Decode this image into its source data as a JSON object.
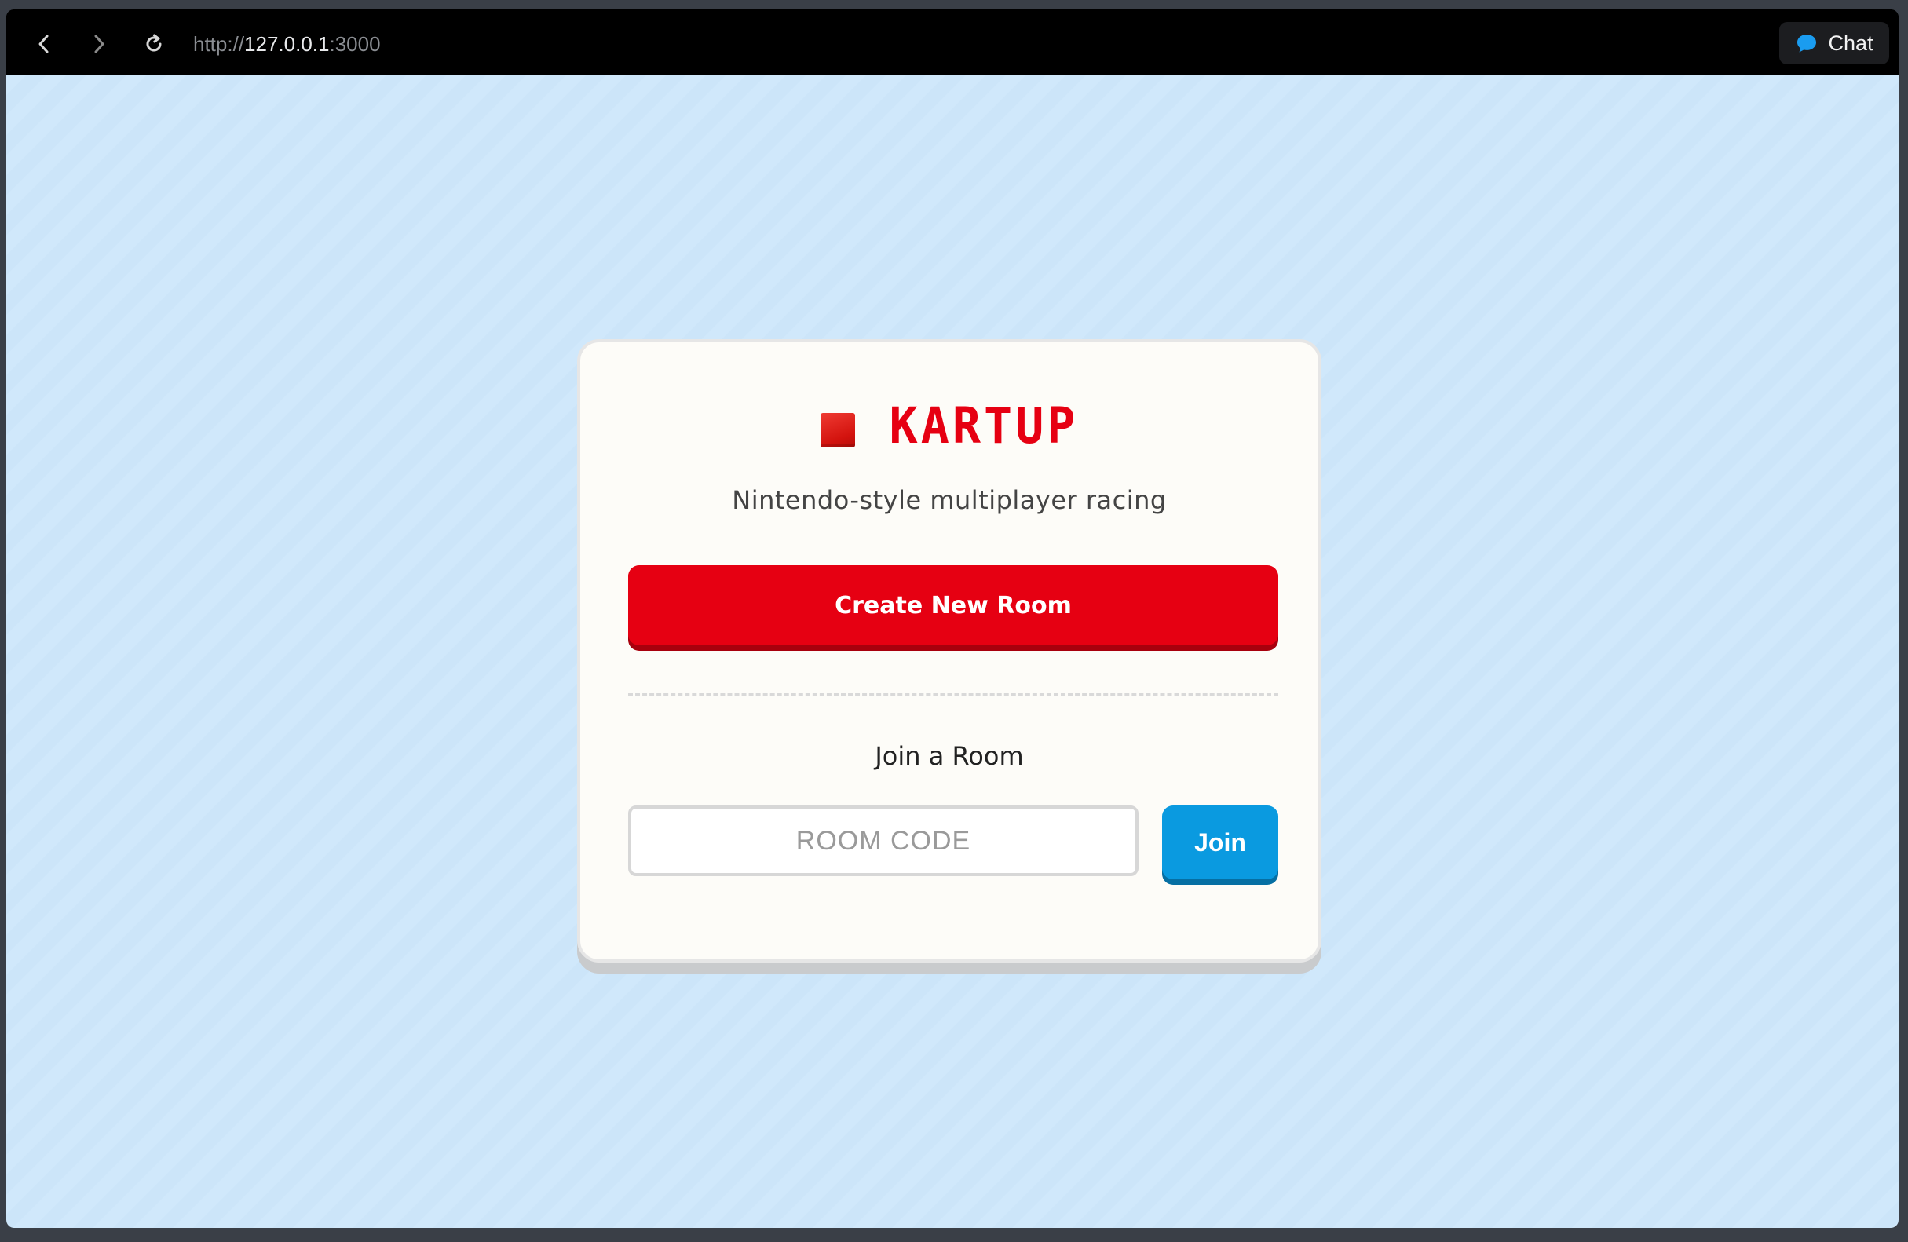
{
  "browser": {
    "url_scheme": "http://",
    "url_host": "127.0.0.1",
    "url_port": ":3000",
    "chat_label": "Chat"
  },
  "colors": {
    "brand_red": "#e60012",
    "join_blue": "#0a9ae0",
    "background": "#d0e8fb",
    "card": "#fdfcf8"
  },
  "icons": {
    "back": "chevron-left-icon",
    "forward": "chevron-right-icon",
    "reload": "reload-icon",
    "chat": "chat-bubble-icon",
    "brand": "red-square-icon"
  },
  "app": {
    "title": "KARTUP",
    "subtitle": "Nintendo-style multiplayer racing",
    "create_label": "Create New Room",
    "join_heading": "Join a Room",
    "room_placeholder": "ROOM CODE",
    "room_value": "",
    "join_label": "Join"
  }
}
